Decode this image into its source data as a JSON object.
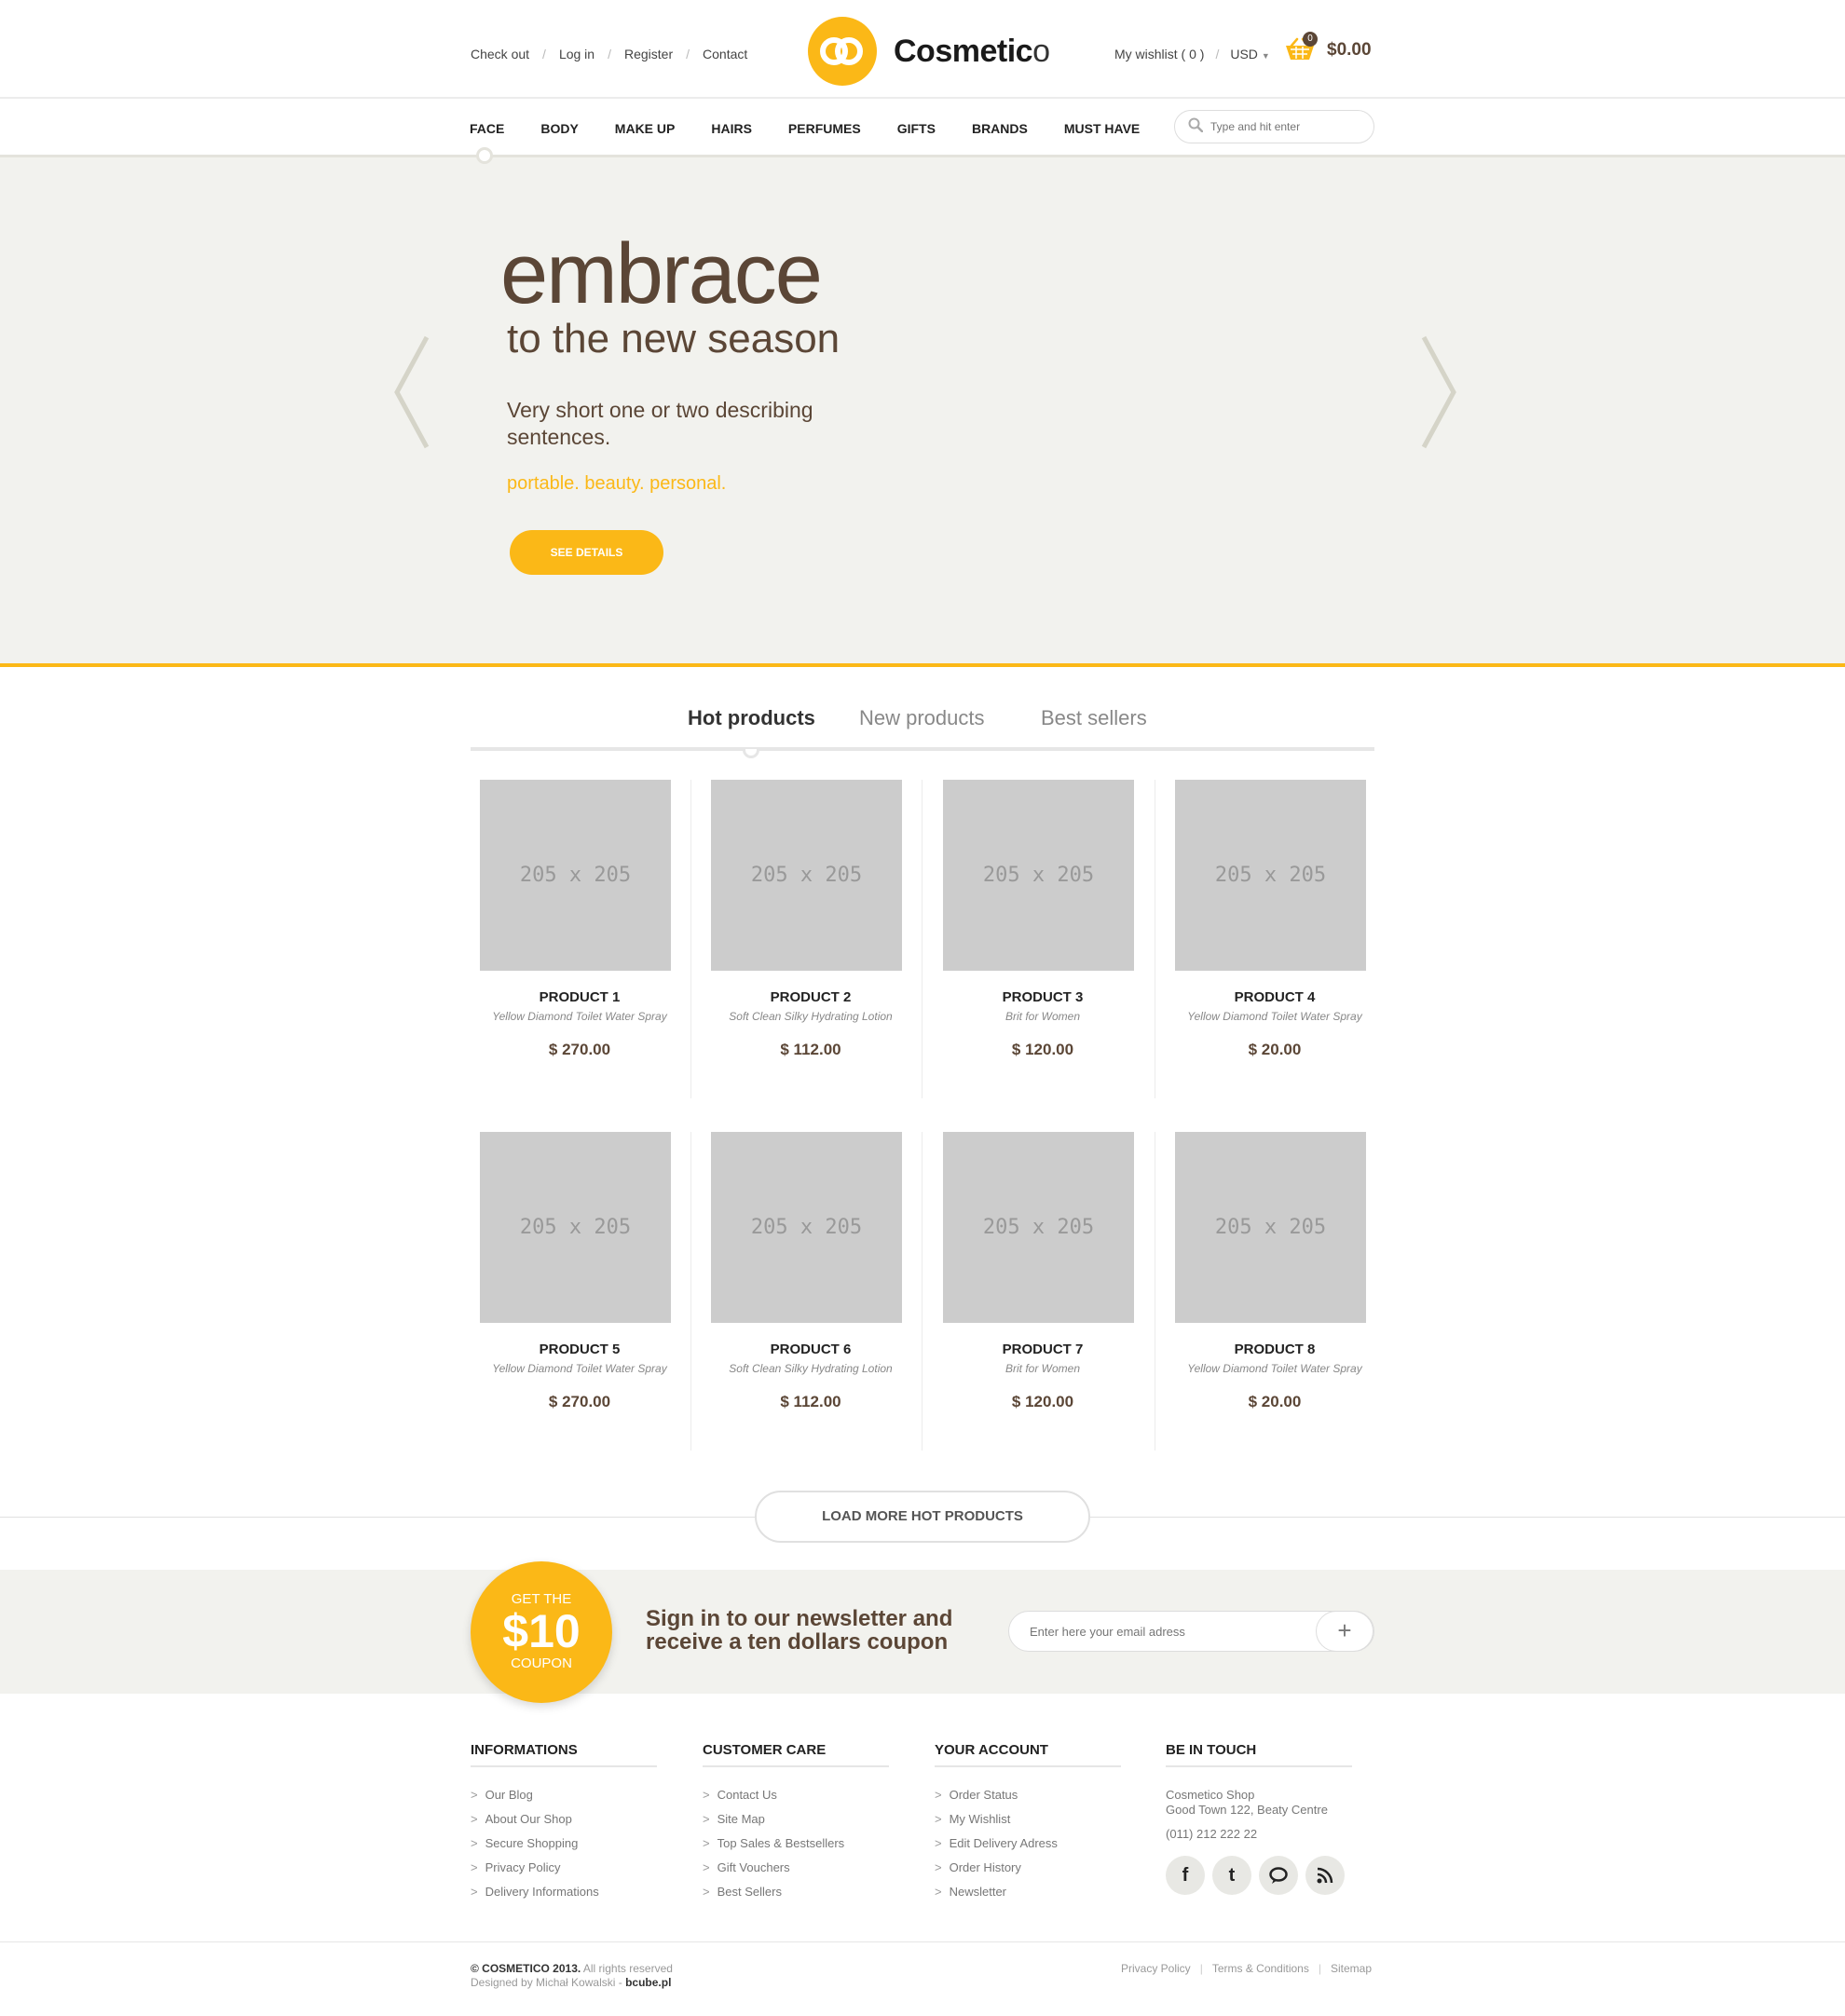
{
  "header": {
    "links": [
      "Check out",
      "Log in",
      "Register",
      "Contact"
    ],
    "logo": {
      "main": "Cosmetic",
      "suffix": "o"
    },
    "wishlist": "My wishlist ( 0 )",
    "currency": "USD",
    "cart_count": "0",
    "cart_total": "$0.00"
  },
  "nav": {
    "items": [
      "FACE",
      "BODY",
      "MAKE UP",
      "HAIRS",
      "PERFUMES",
      "GIFTS",
      "BRANDS",
      "MUST HAVE"
    ],
    "search_placeholder": "Type and hit enter"
  },
  "hero": {
    "title": "embrace",
    "subtitle": "to the new season",
    "description": "Very short one or two describing sentences.",
    "tagline": "portable. beauty. personal.",
    "button": "SEE DETAILS"
  },
  "tabs": [
    "Hot products",
    "New products",
    "Best sellers"
  ],
  "products": [
    {
      "placeholder": "205 x 205",
      "name": "PRODUCT 1",
      "desc": "Yellow Diamond Toilet Water Spray",
      "price": "$ 270.00"
    },
    {
      "placeholder": "205 x 205",
      "name": "PRODUCT 2",
      "desc": "Soft Clean Silky Hydrating Lotion",
      "price": "$ 112.00"
    },
    {
      "placeholder": "205 x 205",
      "name": "PRODUCT 3",
      "desc": "Brit for Women",
      "price": "$ 120.00"
    },
    {
      "placeholder": "205 x 205",
      "name": "PRODUCT 4",
      "desc": "Yellow Diamond Toilet Water Spray",
      "price": "$ 20.00"
    },
    {
      "placeholder": "205 x 205",
      "name": "PRODUCT 5",
      "desc": "Yellow Diamond Toilet Water Spray",
      "price": "$ 270.00"
    },
    {
      "placeholder": "205 x 205",
      "name": "PRODUCT 6",
      "desc": "Soft Clean Silky Hydrating Lotion",
      "price": "$ 112.00"
    },
    {
      "placeholder": "205 x 205",
      "name": "PRODUCT 7",
      "desc": "Brit for Women",
      "price": "$ 120.00"
    },
    {
      "placeholder": "205 x 205",
      "name": "PRODUCT 8",
      "desc": "Yellow Diamond Toilet Water Spray",
      "price": "$ 20.00"
    }
  ],
  "load_more": "LOAD MORE HOT PRODUCTS",
  "newsletter": {
    "coupon_top": "GET THE",
    "coupon_amount": "$10",
    "coupon_bottom": "COUPON",
    "text": "Sign in to our newsletter and receive a ten dollars coupon",
    "email_placeholder": "Enter here your email adress",
    "submit": "+"
  },
  "footer": {
    "informations": {
      "title": "INFORMATIONS",
      "items": [
        "Our Blog",
        "About Our Shop",
        "Secure Shopping",
        "Privacy Policy",
        "Delivery Informations"
      ]
    },
    "customer_care": {
      "title": "CUSTOMER CARE",
      "items": [
        "Contact Us",
        "Site Map",
        "Top Sales & Bestsellers",
        "Gift Vouchers",
        "Best Sellers"
      ]
    },
    "your_account": {
      "title": "YOUR ACCOUNT",
      "items": [
        "Order Status",
        "My Wishlist",
        "Edit Delivery Adress",
        "Order History",
        "Newsletter"
      ]
    },
    "be_in_touch": {
      "title": "BE IN TOUCH",
      "address_line1": "Cosmetico Shop",
      "address_line2": "Good Town 122, Beaty Centre",
      "phone": "(011) 212 222 22",
      "social": [
        "facebook-icon",
        "twitter-icon",
        "chat-icon",
        "rss-icon"
      ]
    },
    "copyright_brand": "© COSMETICO 2013.",
    "copyright_rights": "All rights reserved",
    "designed_by": "Designed by Michał Kowalski - ",
    "designer_site": "bcube.pl",
    "bottom_links": [
      "Privacy Policy",
      "Terms & Conditions",
      "Sitemap"
    ]
  },
  "colors": {
    "accent": "#fbb817",
    "brown": "#5b4636",
    "hero_bg": "#f2f2ee",
    "placeholder_bg": "#cccccc"
  }
}
